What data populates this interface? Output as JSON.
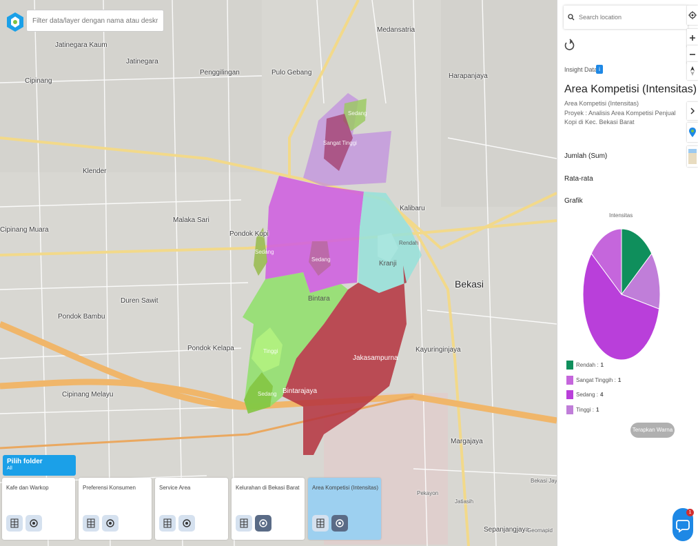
{
  "search": {
    "placeholder": "Filter data/layer dengan nama atau deskripsi"
  },
  "map_labels": [
    "Jatinegara Kaum",
    "Jatinegara",
    "Penggilingan",
    "Pulo Gebang",
    "Medansatria",
    "Harapanjaya",
    "Cipinang",
    "Klender",
    "Malaka Sari",
    "Pondok Kopi",
    "Kalibaru",
    "Bekasi",
    "Cipinang Muara",
    "Duren Sawit",
    "Pondok Bambu",
    "Pondok Kelapa",
    "Kayuringinjaya",
    "Cipinang Melayu",
    "Margajaya",
    "Sepanjangjaya",
    "Bekasi Jaya",
    "Jatiasih",
    "Pekayon",
    "Kranji",
    "Bintara",
    "Jakasampurna",
    "Bintarajaya",
    "Geomapid"
  ],
  "polygon_labels": {
    "sedang_top": "Sedang",
    "tinggi_top": "Sangat Tinggi",
    "sedang_mid": "Sedang",
    "sedang_left": "Sedang",
    "tinggi": "Tinggi",
    "sedang_bottom": "Sedang",
    "rendah": "Rendah"
  },
  "folder": {
    "title": "Pilih folder",
    "subtitle": "All"
  },
  "layers": [
    {
      "label": "Kafe dan Warkop"
    },
    {
      "label": "Preferensi Konsumen"
    },
    {
      "label": "Service Area"
    },
    {
      "label": "Kelurahan di Bekasi Barat"
    },
    {
      "label": "Area Kompetisi (Intensitas)"
    }
  ],
  "panel": {
    "search_placeholder": "Search location",
    "insight_label": "Insight Data",
    "info_badge": "i",
    "title": "Area Kompetisi (Intensitas)",
    "subtitle": "Area Kompetisi (Intensitas)",
    "project": "Proyek : Analisis Area Kompetisi Penjual Kopi di Kec. Bekasi Barat",
    "sum_label": "Jumlah (Sum)",
    "avg_label": "Rata-rata",
    "chart_label": "Grafik",
    "apply_button": "Terapkan Warna",
    "chat_badge": "1"
  },
  "chart_data": {
    "type": "pie",
    "title": "Intensitas",
    "categories": [
      "Rendah",
      "Sangat Tinggih",
      "Sedang",
      "Tinggi"
    ],
    "values": [
      1,
      1,
      4,
      1
    ],
    "colors": [
      "#0f8f5c",
      "#c566dc",
      "#b93fda",
      "#c07ed9"
    ],
    "legend_position": "bottom"
  },
  "colors": {
    "brand": "#1ba0e8",
    "active_card": "#9dd0f0"
  }
}
